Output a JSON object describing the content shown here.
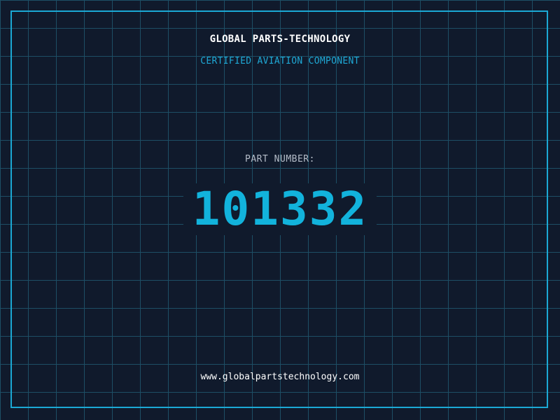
{
  "header": {
    "company": "GLOBAL PARTS-TECHNOLOGY",
    "tagline": "CERTIFIED AVIATION COMPONENT"
  },
  "part": {
    "label": "PART NUMBER:",
    "number": "101332"
  },
  "footer": {
    "website": "www.globalpartstechnology.com"
  },
  "colors": {
    "background": "#101a2c",
    "grid": "#1d4f66",
    "accent": "#1ba8d4",
    "part_number": "#12b3dc"
  }
}
